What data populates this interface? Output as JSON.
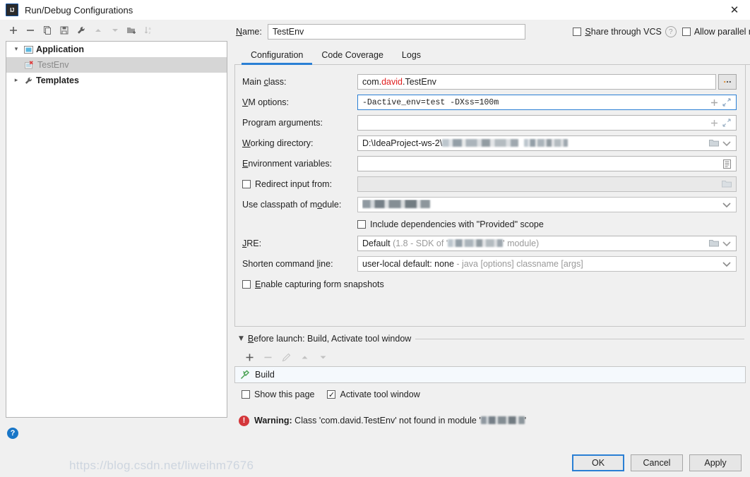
{
  "window": {
    "title": "Run/Debug Configurations",
    "app_icon": "intellij-idea-icon",
    "close_label": "✕"
  },
  "tree_toolbar": {
    "buttons": [
      {
        "name": "add-configuration-button",
        "icon": "plus-icon",
        "label": "+",
        "enabled": true
      },
      {
        "name": "remove-configuration-button",
        "icon": "minus-icon",
        "label": "−",
        "enabled": true
      },
      {
        "name": "copy-configuration-button",
        "icon": "copy-icon",
        "label": "copy",
        "enabled": true
      },
      {
        "name": "save-configuration-button",
        "icon": "save-icon",
        "label": "save",
        "enabled": true
      },
      {
        "name": "edit-templates-button",
        "icon": "wrench-icon",
        "label": "wrench",
        "enabled": true
      },
      {
        "name": "move-up-button",
        "icon": "arrow-up-icon",
        "label": "▲",
        "enabled": false
      },
      {
        "name": "move-down-button",
        "icon": "arrow-down-icon",
        "label": "▼",
        "enabled": false
      },
      {
        "name": "new-folder-button",
        "icon": "new-folder-icon",
        "label": "folder",
        "enabled": true
      },
      {
        "name": "sort-alphabetically-button",
        "icon": "sort-az-icon",
        "label": "sort",
        "enabled": false
      }
    ]
  },
  "tree": {
    "nodes": [
      {
        "label": "Application",
        "icon": "application-icon",
        "expanded": true,
        "arrow": "▾",
        "bold": true,
        "selected": false
      },
      {
        "label": "TestEnv",
        "icon": "application-error-icon",
        "arrow": "",
        "bold": false,
        "selected": true,
        "error": true
      },
      {
        "label": "Templates",
        "icon": "wrench-icon",
        "expanded": false,
        "arrow": "▸",
        "bold": true,
        "selected": false
      }
    ]
  },
  "help": {
    "icon": "help-icon",
    "label": "?"
  },
  "name_row": {
    "label": "Name:",
    "value": "TestEnv",
    "placeholder": "",
    "share_vcs": {
      "label": "Share through VCS",
      "checked": false,
      "help_icon": "help-question-icon",
      "help_label": "?"
    },
    "allow_parallel": {
      "label": "Allow parallel run",
      "checked": false
    }
  },
  "tabs": [
    {
      "label": "Configuration",
      "active": true
    },
    {
      "label": "Code Coverage",
      "active": false
    },
    {
      "label": "Logs",
      "active": false
    }
  ],
  "form": {
    "main_class": {
      "label": "Main class:",
      "value_prefix": "com.",
      "value_highlight": "david",
      "value_suffix": ".TestEnv",
      "browse_label": "…",
      "browse_icon": "ellipsis-icon"
    },
    "vm_options": {
      "label": "VM options:",
      "value": "-Dactive_env=test -DXss=100m",
      "focused": true,
      "insert_icon": "plus-icon",
      "expand_icon": "expand-icon"
    },
    "program_arguments": {
      "label": "Program arguments:",
      "value": "",
      "insert_icon": "plus-icon",
      "expand_icon": "expand-icon"
    },
    "working_directory": {
      "label": "Working directory:",
      "value": "D:\\IdeaProject-ws-2\\",
      "redacted": true,
      "folder_icon": "folder-icon",
      "dropdown_icon": "chevron-down-icon"
    },
    "environment_variables": {
      "label": "Environment variables:",
      "value": "",
      "edit_icon": "list-edit-icon"
    },
    "redirect_input": {
      "label": "Redirect input from:",
      "checked": false,
      "value": "",
      "disabled": true,
      "folder_icon": "folder-icon"
    },
    "classpath_module": {
      "label": "Use classpath of module:",
      "value": "",
      "redacted": true,
      "module_icon": "module-icon",
      "dropdown_icon": "chevron-down-icon"
    },
    "include_provided": {
      "label": "Include dependencies with \"Provided\" scope",
      "checked": false
    },
    "jre": {
      "label": "JRE:",
      "value_bold": "Default",
      "value_detail_prefix": " (1.8 - SDK of '",
      "value_detail_suffix": "' module)",
      "redacted": true,
      "folder_icon": "folder-icon",
      "dropdown_icon": "chevron-down-icon"
    },
    "shorten_command_line": {
      "label": "Shorten command line:",
      "value_bold": "user-local default: none",
      "value_detail": " - java [options] classname [args]",
      "dropdown_icon": "chevron-down-icon"
    },
    "form_snapshots": {
      "label": "Enable capturing form snapshots",
      "checked": false
    }
  },
  "before_launch": {
    "title": "Before launch: Build, Activate tool window",
    "collapse_icon": "triangle-down-icon",
    "toolbar": [
      {
        "name": "add-task-button",
        "icon": "plus-icon",
        "label": "+",
        "enabled": true
      },
      {
        "name": "remove-task-button",
        "icon": "minus-icon",
        "label": "−",
        "enabled": false
      },
      {
        "name": "edit-task-button",
        "icon": "pencil-icon",
        "label": "edit",
        "enabled": false
      },
      {
        "name": "task-move-up-button",
        "icon": "arrow-up-icon",
        "label": "▲",
        "enabled": false
      },
      {
        "name": "task-move-down-button",
        "icon": "arrow-down-icon",
        "label": "▼",
        "enabled": false
      }
    ],
    "tasks": [
      {
        "label": "Build",
        "icon": "build-hammer-icon"
      }
    ],
    "show_this_page": {
      "label": "Show this page",
      "checked": false
    },
    "activate_tool_window": {
      "label": "Activate tool window",
      "checked": true
    }
  },
  "warning": {
    "icon": "error-icon",
    "prefix": "Warning:",
    "text_before": " Class 'com.david.TestEnv' not found in module '",
    "redacted": true,
    "text_after": "'"
  },
  "footer": {
    "buttons": [
      {
        "label": "OK",
        "name": "ok-button",
        "default": true
      },
      {
        "label": "Cancel",
        "name": "cancel-button",
        "default": false
      },
      {
        "label": "Apply",
        "name": "apply-button",
        "default": false
      }
    ],
    "watermark": "https://blog.csdn.net/liweihm7676"
  },
  "colors": {
    "accent": "#2a7fd4",
    "error": "#d4373b",
    "warning_red": "#e02020",
    "build_green": "#4aa254",
    "selection": "#d6d6d6"
  }
}
